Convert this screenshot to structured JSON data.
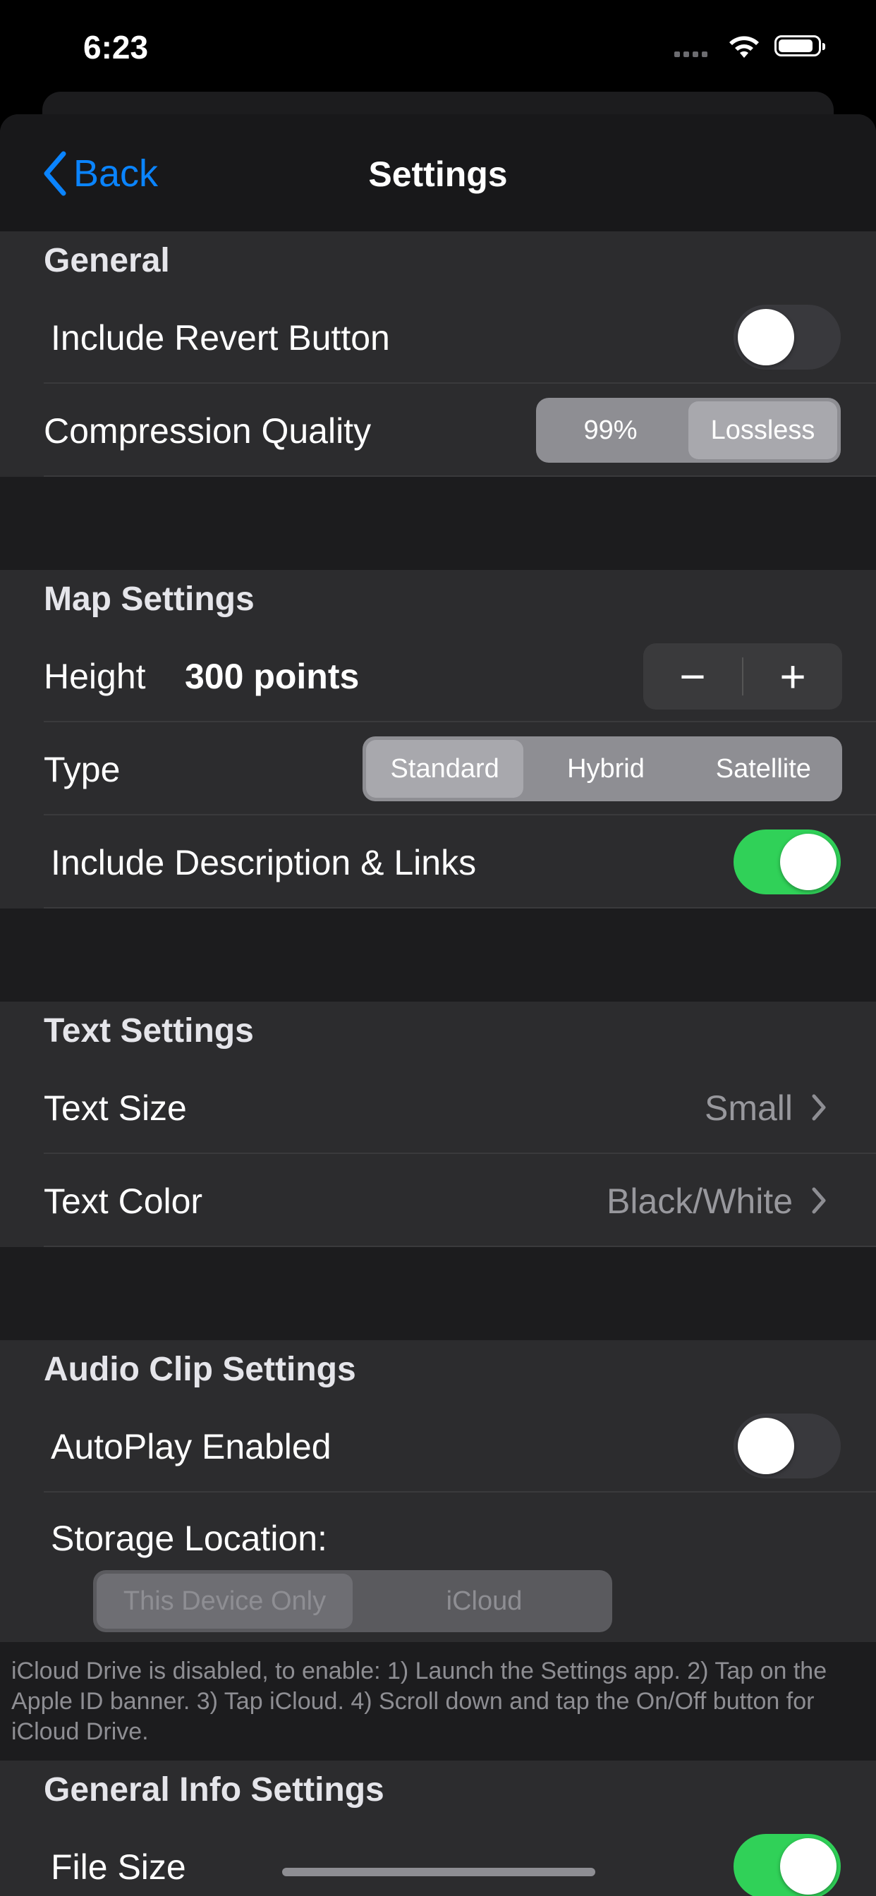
{
  "status_bar": {
    "time": "6:23"
  },
  "nav": {
    "back_label": "Back",
    "title": "Settings"
  },
  "general": {
    "header": "General",
    "revert_label": "Include Revert Button",
    "revert_on": false,
    "compression_label": "Compression Quality",
    "compression_options": [
      "99%",
      "Lossless"
    ],
    "compression_selected": "Lossless"
  },
  "map": {
    "header": "Map Settings",
    "height_label": "Height",
    "height_value": "300 points",
    "minus": "−",
    "plus": "+",
    "type_label": "Type",
    "type_options": [
      "Standard",
      "Hybrid",
      "Satellite"
    ],
    "type_selected": "Standard",
    "desc_label": "Include Description & Links",
    "desc_on": true
  },
  "text": {
    "header": "Text Settings",
    "size_label": "Text Size",
    "size_value": "Small",
    "color_label": "Text Color",
    "color_value": "Black/White"
  },
  "audio": {
    "header": "Audio Clip Settings",
    "autoplay_label": "AutoPlay Enabled",
    "autoplay_on": false,
    "storage_label": "Storage Location:",
    "storage_options": [
      "This Device Only",
      "iCloud"
    ],
    "storage_selected": "This Device Only",
    "icloud_note": "iCloud Drive is disabled, to enable: 1) Launch the Settings app. 2) Tap on the Apple ID banner. 3) Tap iCloud.  4) Scroll down and tap the On/Off button for iCloud Drive."
  },
  "general_info": {
    "header": "General Info Settings",
    "file_size_label": "File Size",
    "file_size_on": true
  },
  "colors": {
    "accent": "#0a84ff",
    "toggle_on": "#30d158",
    "toggle_off": "#39393d"
  }
}
